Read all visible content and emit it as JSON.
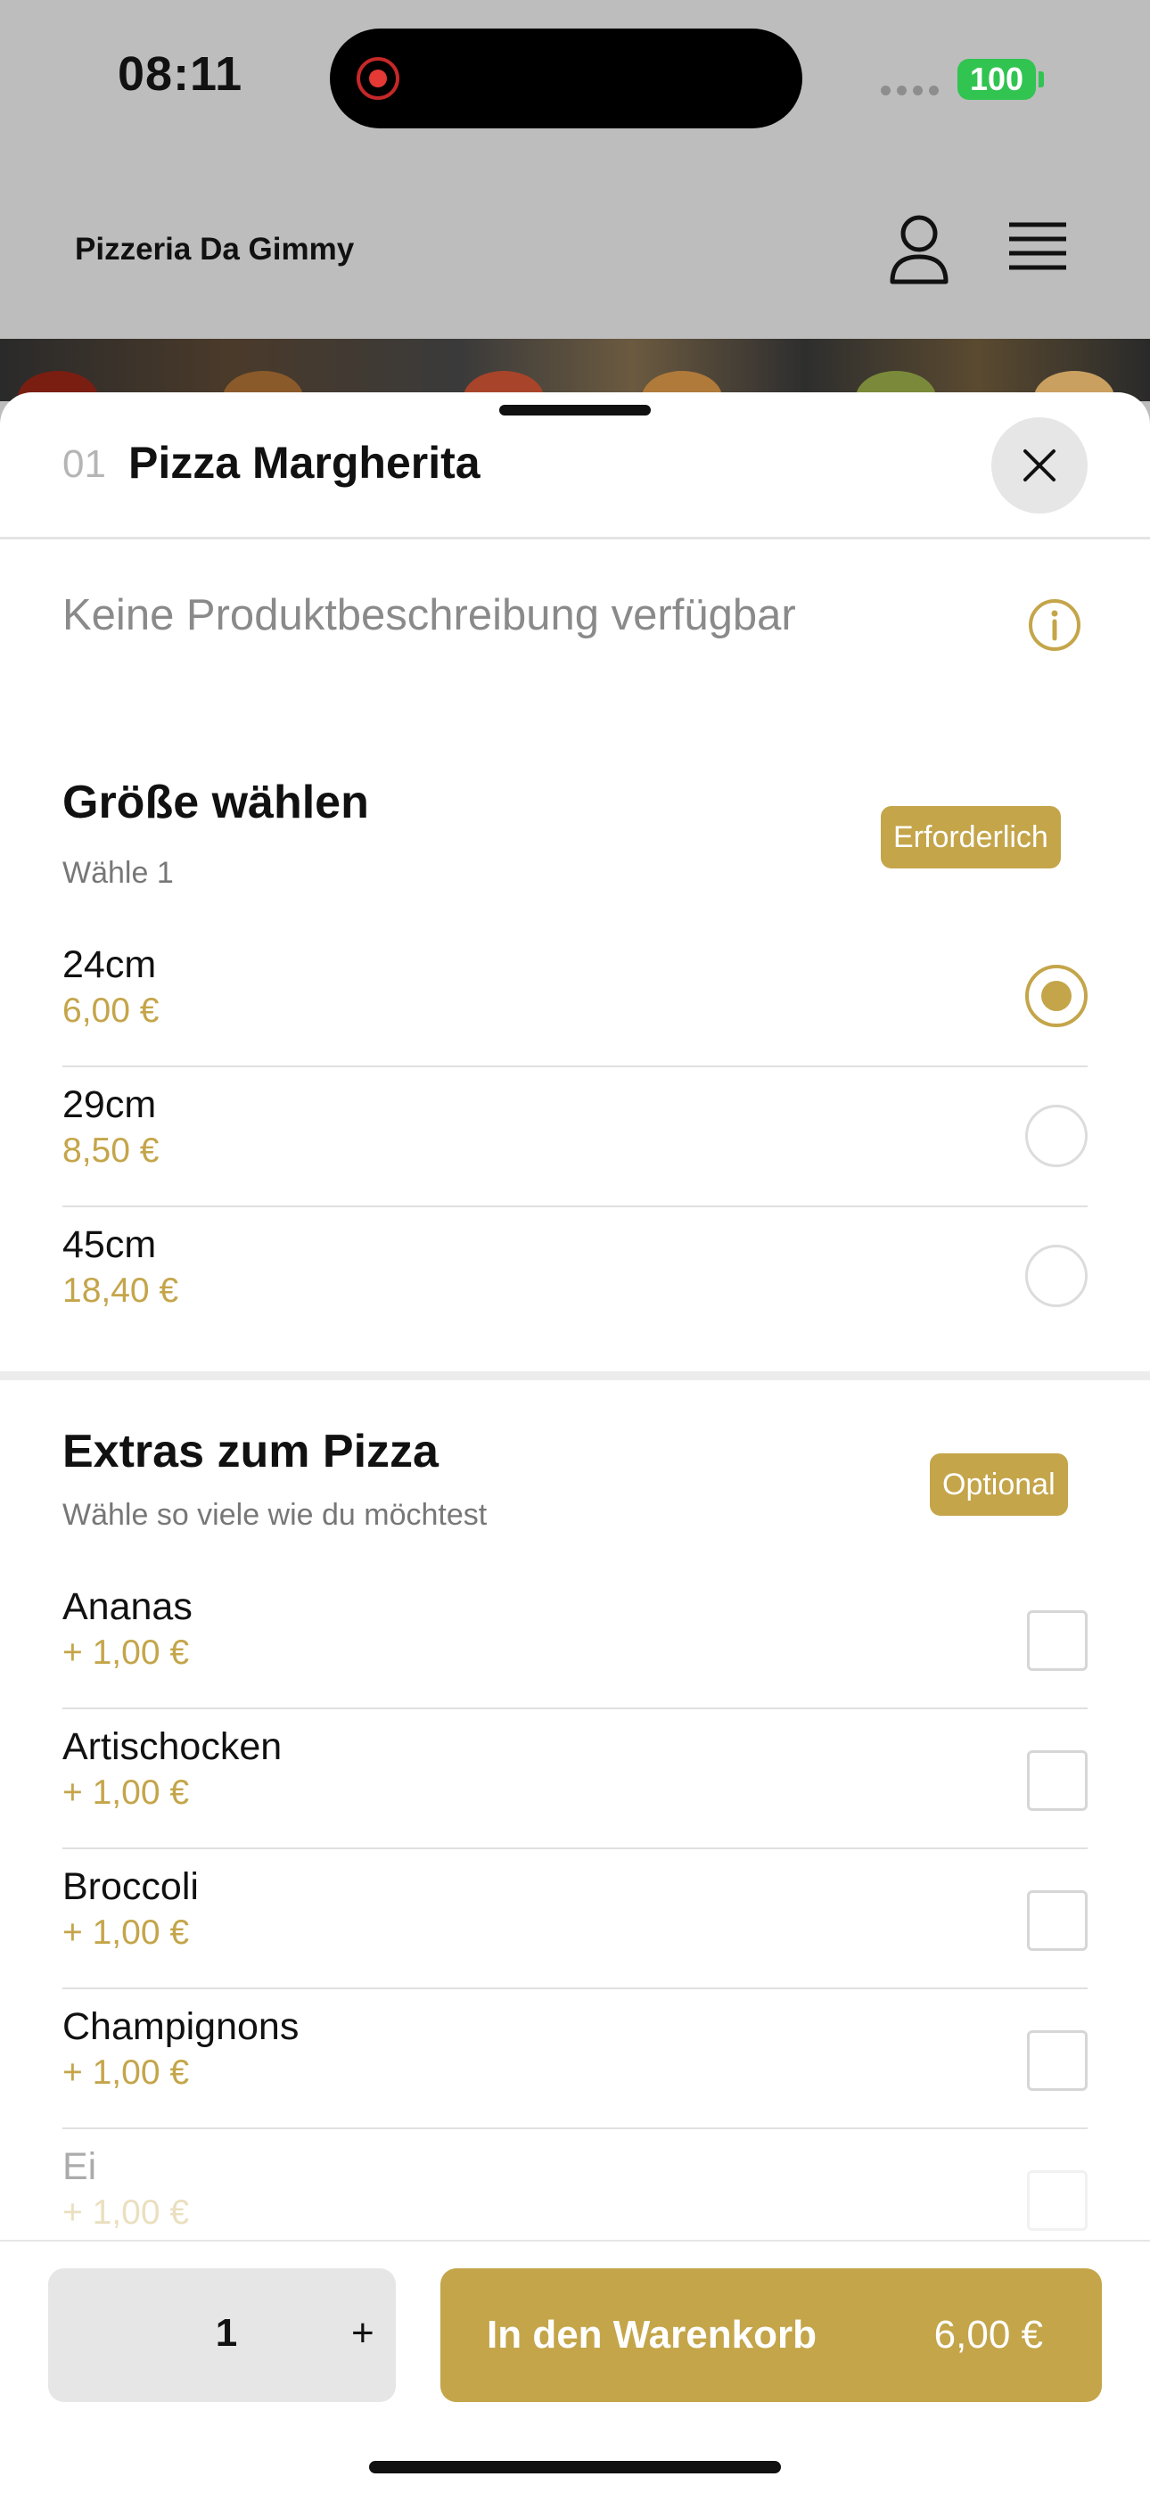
{
  "status_bar": {
    "time": "08:11",
    "battery": "100"
  },
  "header": {
    "brand": "Pizzeria Da Gimmy"
  },
  "product": {
    "number": "01",
    "title": "Pizza Margherita",
    "description": "Keine Produktbeschreibung verfügbar"
  },
  "size_section": {
    "title": "Größe wählen",
    "subtitle": "Wähle 1",
    "badge": "Erforderlich",
    "options": [
      {
        "name": "24cm",
        "price": "6,00 €",
        "selected": true
      },
      {
        "name": "29cm",
        "price": "8,50 €",
        "selected": false
      },
      {
        "name": "45cm",
        "price": "18,40 €",
        "selected": false
      }
    ]
  },
  "extras_section": {
    "title": "Extras zum Pizza",
    "subtitle": "Wähle so viele wie du möchtest",
    "badge": "Optional",
    "options": [
      {
        "name": "Ananas",
        "price": "+ 1,00 €"
      },
      {
        "name": "Artischocken",
        "price": "+ 1,00 €"
      },
      {
        "name": "Broccoli",
        "price": "+ 1,00 €"
      },
      {
        "name": "Champignons",
        "price": "+ 1,00 €"
      },
      {
        "name": "Ei",
        "price": "+ 1,00 €"
      }
    ]
  },
  "bottom_bar": {
    "quantity": "1",
    "plus": "+",
    "cart_label": "In den Warenkorb",
    "cart_price": "6,00 €"
  },
  "colors": {
    "accent": "#c4a54a",
    "header_bg": "#bdbdbd",
    "battery": "#31c451"
  },
  "icons": [
    "record-icon",
    "signal-icon",
    "battery-icon",
    "user-icon",
    "menu-icon",
    "close-icon",
    "info-icon"
  ]
}
